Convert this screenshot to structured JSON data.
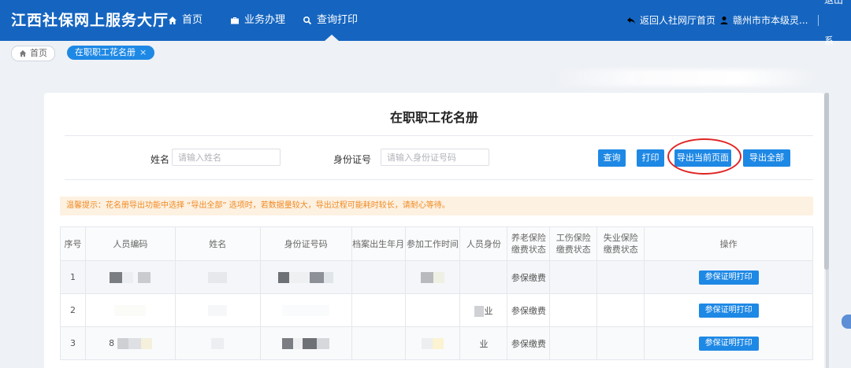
{
  "header": {
    "brand": "江西社保网上服务大厅",
    "nav": [
      {
        "label": "首页",
        "icon": "home-icon"
      },
      {
        "label": "业务办理",
        "icon": "briefcase-icon"
      },
      {
        "label": "查询打印",
        "icon": "search-icon"
      }
    ],
    "back_label": "返回人社网厅首页",
    "user_label": "赣州市市本级灵...",
    "logout_label": "退出系"
  },
  "tabs": {
    "home_label": "首页",
    "active_label": "在职职工花名册",
    "close_glyph": "×"
  },
  "page": {
    "title": "在职职工花名册",
    "name_label": "姓名",
    "name_placeholder": "请输入姓名",
    "id_label": "身份证号",
    "id_placeholder": "请输入身份证号码",
    "buttons": {
      "query": "查询",
      "print": "打印",
      "export_page": "导出当前页面",
      "export_all": "导出全部"
    },
    "tip": "温馨提示：花名册导出功能中选择 “导出全部” 选项时，若数据量较大，导出过程可能耗时较长，请耐心等待。"
  },
  "table": {
    "headers": {
      "seq": "序号",
      "code": "人员编码",
      "name": "姓名",
      "id": "身份证号码",
      "birth": "档案出生年月",
      "work": "参加工作时间",
      "identity": "人员身份",
      "pension_1": "养老保险",
      "pension_2": "缴费状态",
      "injury_1": "工伤保险",
      "injury_2": "缴费状态",
      "unemp_1": "失业保险",
      "unemp_2": "缴费状态",
      "op": "操作"
    },
    "rows": [
      {
        "seq": "1",
        "code_prefix": "",
        "identity_mark": "",
        "status": "参保缴费",
        "op": "参保证明打印"
      },
      {
        "seq": "2",
        "code_prefix": "",
        "identity_mark": "业",
        "status": "参保缴费",
        "op": "参保证明打印"
      },
      {
        "seq": "3",
        "code_prefix": "8",
        "identity_mark": "业",
        "status": "参保缴费",
        "op": "参保证明打印"
      }
    ]
  },
  "colors": {
    "nav_bg": "#1565c0",
    "accent": "#1e88e5",
    "tip_bg": "#fdf1e1",
    "tip_text": "#f08a24",
    "highlight": "#e02424"
  }
}
